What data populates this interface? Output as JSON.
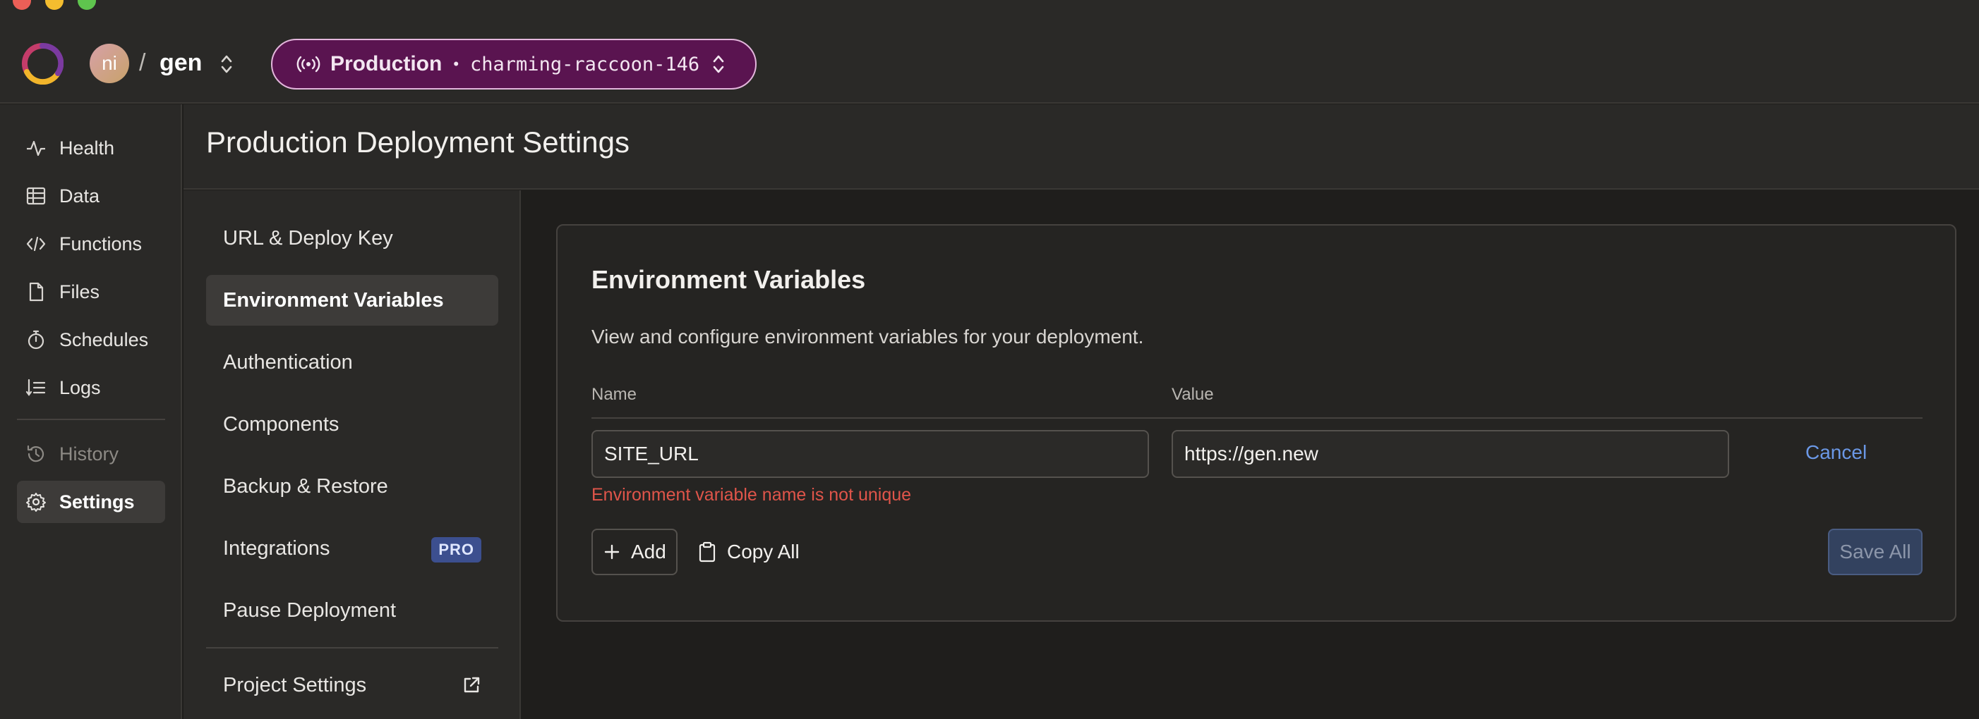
{
  "app": {
    "avatar_initials": "ni",
    "separator": "/",
    "project_name": "gen",
    "deployment": {
      "type_label": "Production",
      "separator": "•",
      "name": "charming-raccoon-146",
      "pill_color": "#5a1450"
    }
  },
  "sidebar": {
    "items": [
      {
        "label": "Health",
        "icon": "activity-icon"
      },
      {
        "label": "Data",
        "icon": "table-icon"
      },
      {
        "label": "Functions",
        "icon": "code-icon"
      },
      {
        "label": "Files",
        "icon": "file-icon"
      },
      {
        "label": "Schedules",
        "icon": "stopwatch-icon"
      },
      {
        "label": "Logs",
        "icon": "logs-icon"
      },
      {
        "label": "History",
        "icon": "history-icon"
      },
      {
        "label": "Settings",
        "icon": "gear-icon",
        "active": true
      }
    ]
  },
  "page": {
    "title": "Production Deployment Settings"
  },
  "settings_nav": {
    "items": [
      {
        "label": "URL & Deploy Key"
      },
      {
        "label": "Environment Variables",
        "active": true
      },
      {
        "label": "Authentication"
      },
      {
        "label": "Components"
      },
      {
        "label": "Backup & Restore"
      },
      {
        "label": "Integrations",
        "badge": "PRO"
      },
      {
        "label": "Pause Deployment"
      },
      {
        "label": "Project Settings",
        "icon": "external-link-icon"
      }
    ]
  },
  "env_vars": {
    "title": "Environment Variables",
    "description": "View and configure environment variables for your deployment.",
    "col_name": "Name",
    "col_value": "Value",
    "row": {
      "name": "SITE_URL",
      "value": "https://gen.new",
      "cancel_label": "Cancel",
      "error": "Environment variable name is not unique"
    },
    "add_label": "Add",
    "copy_all_label": "Copy All",
    "save_all_label": "Save All"
  },
  "colors": {
    "accent_link": "#6b98e6",
    "error": "#e0554a",
    "pro_badge": "#3c4f8f"
  }
}
